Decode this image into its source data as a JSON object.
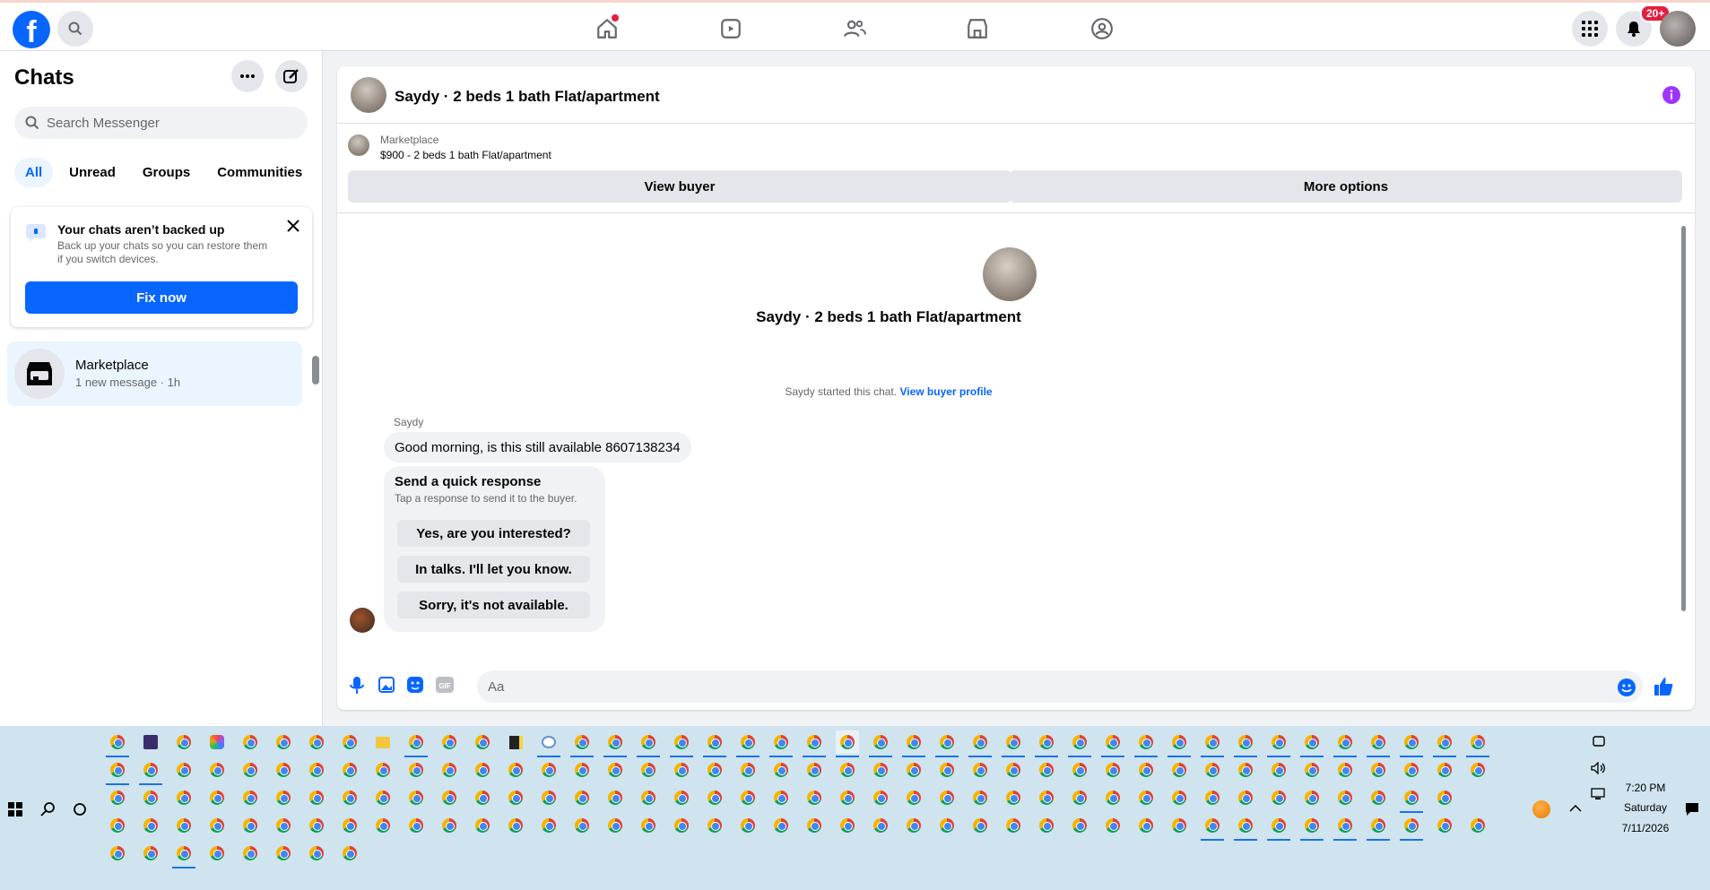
{
  "top_nav": {
    "notification_badge": "20+"
  },
  "sidebar": {
    "title": "Chats",
    "search_placeholder": "Search Messenger",
    "tabs": [
      "All",
      "Unread",
      "Groups",
      "Communities"
    ],
    "backup_card": {
      "title": "Your chats aren’t backed up",
      "text": "Back up your chats so you can restore them if you switch devices.",
      "button": "Fix now"
    },
    "conversations": [
      {
        "name": "Marketplace",
        "subtitle": "1 new message · 1h"
      }
    ]
  },
  "chat": {
    "title": "Saydy · 2 beds 1 bath Flat/apartment",
    "marketplace_label": "Marketplace",
    "listing": "$900 - 2 beds 1 bath Flat/apartment",
    "buttons": {
      "view_buyer": "View buyer",
      "more_options": "More options"
    },
    "center_name": "Saydy · 2 beds 1 bath Flat/apartment",
    "started_text": "Saydy started this chat.",
    "started_link": "View buyer profile",
    "messages": [
      {
        "sender": "Saydy",
        "text": "Good morning, is this still available 8607138234"
      }
    ],
    "quick_response": {
      "title": "Send a quick response",
      "subtitle": "Tap a response to send it to the buyer.",
      "options": [
        "Yes, are you interested?",
        "In talks. I'll let you know.",
        "Sorry, it's not available."
      ]
    },
    "composer_placeholder": "Aa"
  },
  "taskbar": {
    "time": "7:20 PM",
    "day": "Saturday",
    "date": "7/11/2026"
  },
  "colors": {
    "brand": "#0866ff",
    "badge": "#e41e3f",
    "info": "#a033ff"
  }
}
